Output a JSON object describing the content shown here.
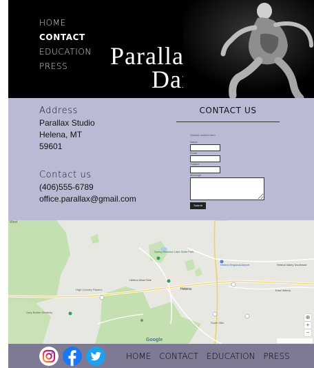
{
  "header": {
    "nav": [
      "HOME",
      "CONTACT",
      "EDUCATION",
      "PRESS"
    ],
    "active": "CONTACT",
    "brand_line1": "Parallax",
    "brand_line2": "Dance"
  },
  "contact": {
    "address_heading": "Address",
    "address_lines": [
      "Parallax Studio",
      "Helena, MT",
      "59601"
    ],
    "contact_heading": "Contact us",
    "phone": "(406)555-6789",
    "email": "office.parallax@gmail.com"
  },
  "form": {
    "title": "CONTACT US",
    "caption": "Sample contact form",
    "labels": [
      "Name",
      "Email",
      "Subject",
      "Message"
    ],
    "submit": "Submit"
  },
  "map": {
    "labels": {
      "spring_meadow": "Spring Meadow Lake State Park",
      "helena_west": "Helena West Side",
      "helena": "Helena",
      "helena_airport": "Helena Regional Airport",
      "helena_valley": "Helena Valley Southeast",
      "east_helena": "East Helena",
      "high_country": "High Country Flowers",
      "gary_buhler": "Gary Buhler Dentistry",
      "south_hills": "South Hills",
      "west": "West"
    },
    "google": "Google"
  },
  "footer": {
    "social": [
      "instagram",
      "facebook",
      "twitter"
    ],
    "nav": [
      "HOME",
      "CONTACT",
      "EDUCATION",
      "PRESS"
    ]
  },
  "colors": {
    "header_bg": "#000000",
    "contact_bg": "#b8bbd3",
    "footer_bg": "#7f7a94",
    "facebook": "#1877f2",
    "twitter": "#1da1f2"
  }
}
